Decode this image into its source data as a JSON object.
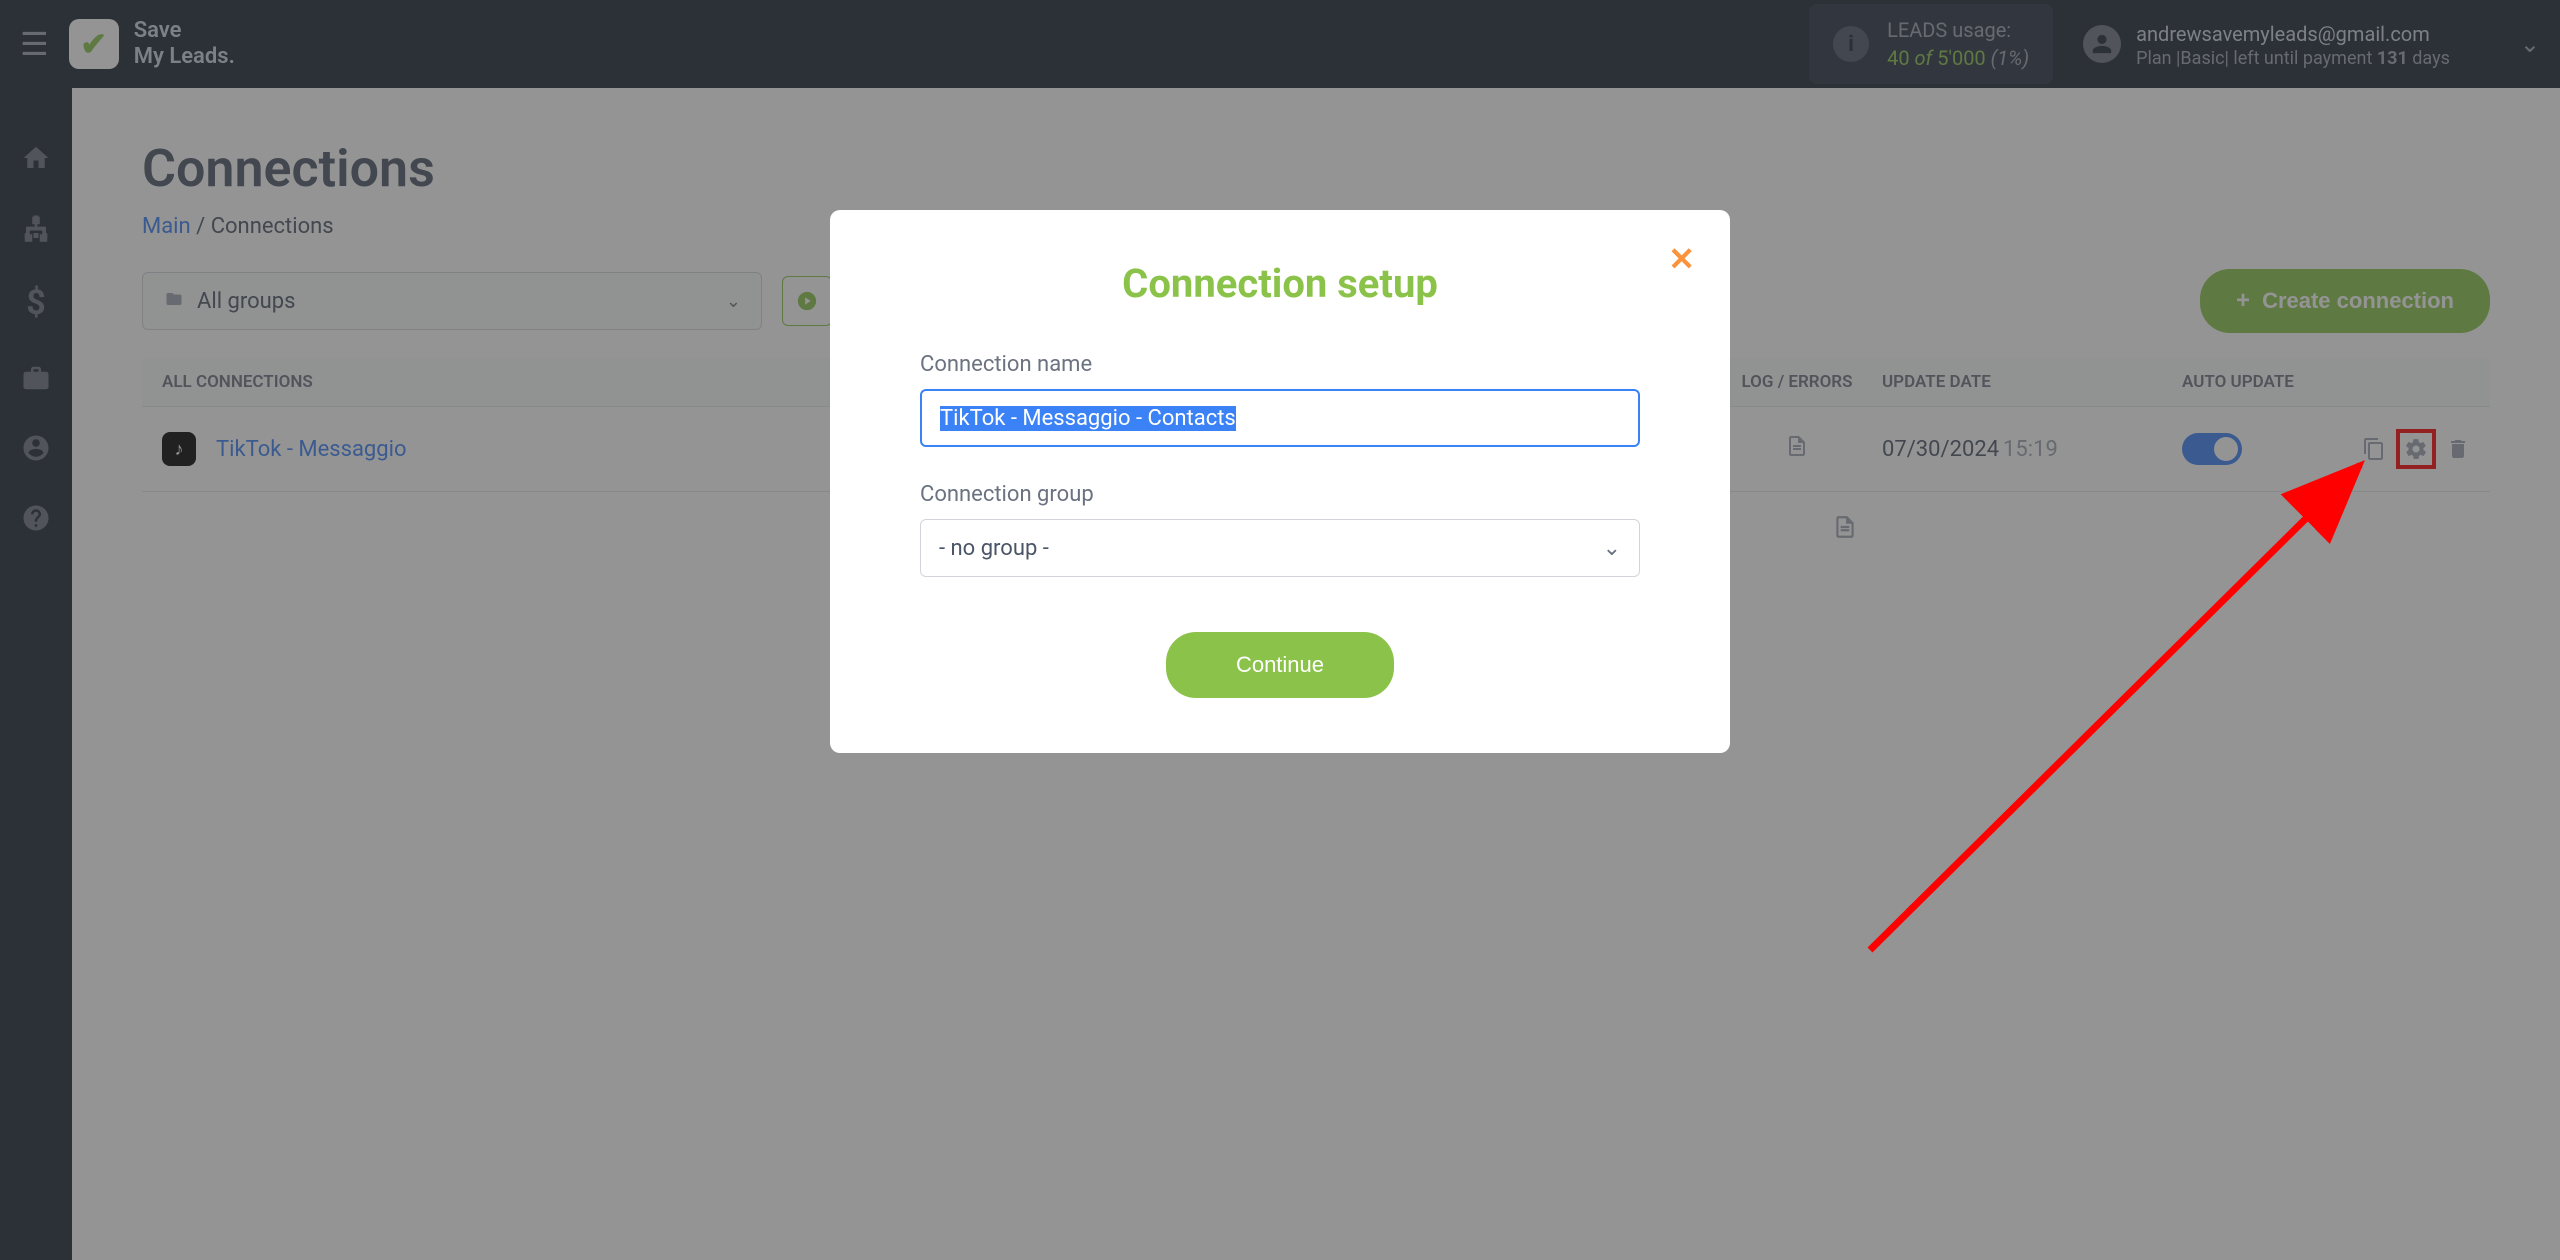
{
  "brand": {
    "line1": "Save",
    "line2": "My Leads."
  },
  "header": {
    "usage_label": "LEADS usage:",
    "usage_current": "40",
    "usage_of": " of ",
    "usage_total": "5'000",
    "usage_pct": " (1%)",
    "email": "andrewsavemyleads@gmail.com",
    "plan_prefix": "Plan |Basic| left until payment ",
    "plan_days": "131",
    "plan_suffix": " days"
  },
  "page": {
    "title": "Connections",
    "breadcrumb_main": "Main",
    "breadcrumb_sep": " / ",
    "breadcrumb_current": "Connections"
  },
  "toolbar": {
    "groups_label": "All groups",
    "create_label": "Create connection"
  },
  "table": {
    "col_all": "ALL CONNECTIONS",
    "col_log": "LOG / ERRORS",
    "col_date": "UPDATE DATE",
    "col_auto": "AUTO UPDATE",
    "rows": [
      {
        "name": "TikTok - Messaggio",
        "date": "07/30/2024",
        "time": "15:19",
        "auto_update": true
      }
    ]
  },
  "modal": {
    "title": "Connection setup",
    "name_label": "Connection name",
    "name_value": "TikTok - Messaggio - Contacts",
    "group_label": "Connection group",
    "group_value": "- no group -",
    "continue_label": "Continue"
  }
}
